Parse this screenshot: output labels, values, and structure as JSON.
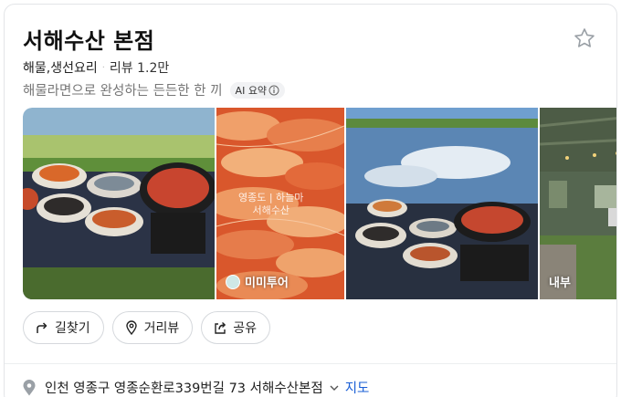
{
  "place": {
    "name": "서해수산 본점",
    "category": "해물,생선요리",
    "separator": "·",
    "reviews": "리뷰 1.2만",
    "description": "해물라면으로 완성하는 든든한 한 끼",
    "ai_badge": "AI 요약"
  },
  "photos": [
    {
      "label": ""
    },
    {
      "label": "미미투어",
      "watermark_line1": "영종도 | 하늘마",
      "watermark_line2": "서해수산"
    },
    {
      "label": ""
    },
    {
      "label": "내부"
    }
  ],
  "actions": [
    {
      "label": "길찾기",
      "icon": "directions-icon"
    },
    {
      "label": "거리뷰",
      "icon": "street-view-pin-icon"
    },
    {
      "label": "공유",
      "icon": "share-icon"
    }
  ],
  "address": {
    "text": "인천 영종구 영종순환로339번길 73 서해수산본점",
    "map_link": "지도"
  },
  "colors": {
    "link": "#1a5fd6",
    "muted": "#767676",
    "border": "#d5d8dc"
  }
}
